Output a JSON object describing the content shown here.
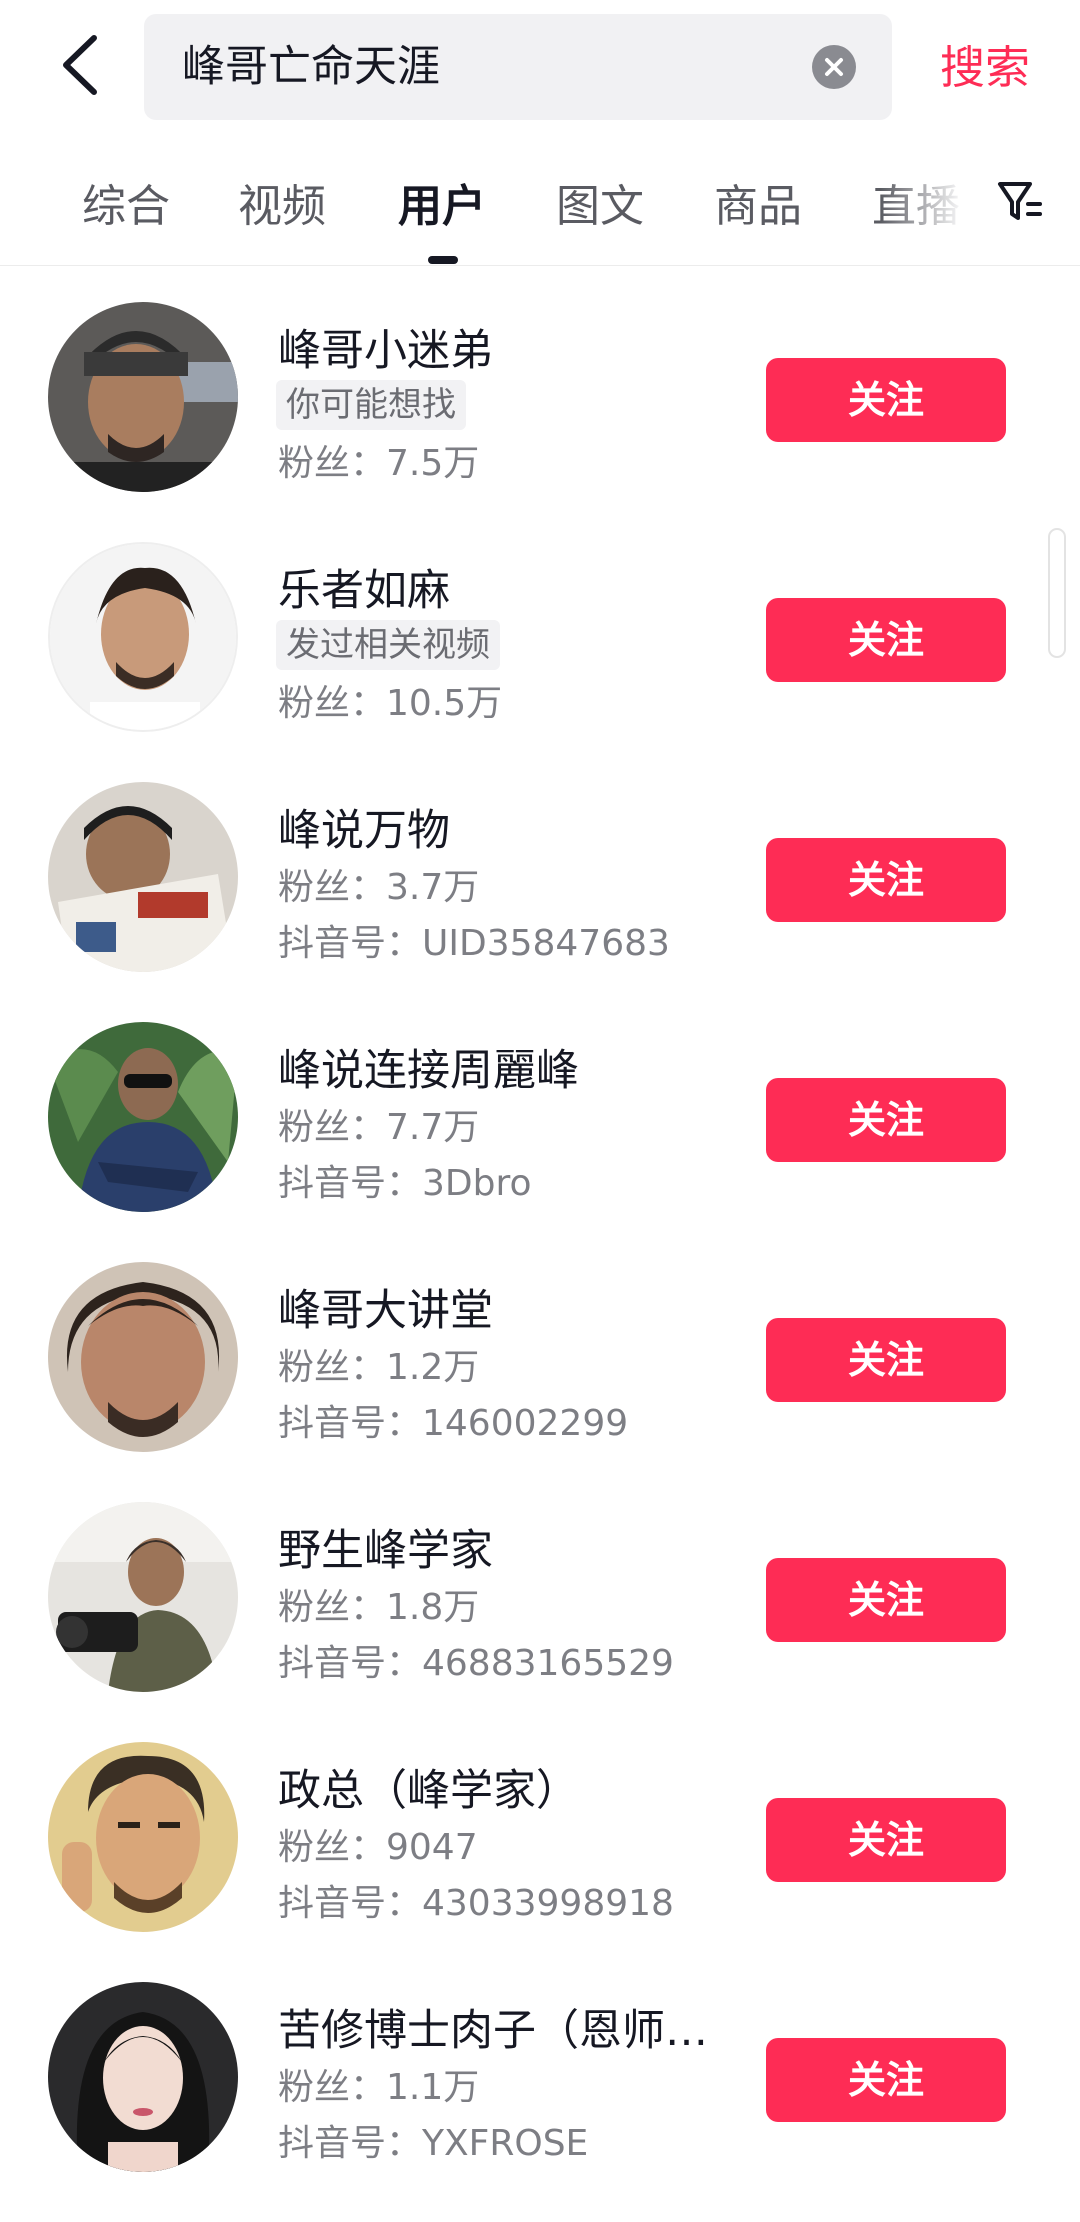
{
  "search": {
    "query": "峰哥亡命天涯",
    "submit_label": "搜索"
  },
  "tabs": [
    {
      "label": "综合"
    },
    {
      "label": "视频"
    },
    {
      "label": "用户"
    },
    {
      "label": "图文"
    },
    {
      "label": "商品"
    },
    {
      "label": "直播"
    }
  ],
  "active_tab": "用户",
  "colors": {
    "accent": "#fe2c55",
    "text": "#161823",
    "secondary": "#7d7e84"
  },
  "users": [
    {
      "name": "峰哥小迷弟",
      "tag": "你可能想找",
      "line2": "",
      "line3": "粉丝：7.5万",
      "follow_label": "关注",
      "avatar": "avatar-man-beanie"
    },
    {
      "name": "乐者如麻",
      "tag": "发过相关视频",
      "line2": "",
      "line3": "粉丝：10.5万",
      "follow_label": "关注",
      "avatar": "avatar-man-portrait"
    },
    {
      "name": "峰说万物",
      "tag": "",
      "line2": "粉丝：3.7万",
      "line3": "抖音号：UID35847683",
      "follow_label": "关注",
      "avatar": "avatar-man-reading"
    },
    {
      "name": "峰说连接周麗峰",
      "tag": "",
      "line2": "粉丝：7.7万",
      "line3": "抖音号：3Dbro",
      "follow_label": "关注",
      "avatar": "avatar-man-sunglasses"
    },
    {
      "name": "峰哥大讲堂",
      "tag": "",
      "line2": "粉丝：1.2万",
      "line3": "抖音号：146002299",
      "follow_label": "关注",
      "avatar": "avatar-man-closeup"
    },
    {
      "name": "野生峰学家",
      "tag": "",
      "line2": "粉丝：1.8万",
      "line3": "抖音号：46883165529",
      "follow_label": "关注",
      "avatar": "avatar-man-camera"
    },
    {
      "name": "政总（峰学家）",
      "tag": "",
      "line2": "粉丝：9047",
      "line3": "抖音号：43033998918",
      "follow_label": "关注",
      "avatar": "avatar-cartoon-man"
    },
    {
      "name": "苦修博士肉子（恩师…",
      "tag": "",
      "line2": "粉丝：1.1万",
      "line3": "抖音号：YXFROSE",
      "follow_label": "关注",
      "avatar": "avatar-woman"
    }
  ]
}
